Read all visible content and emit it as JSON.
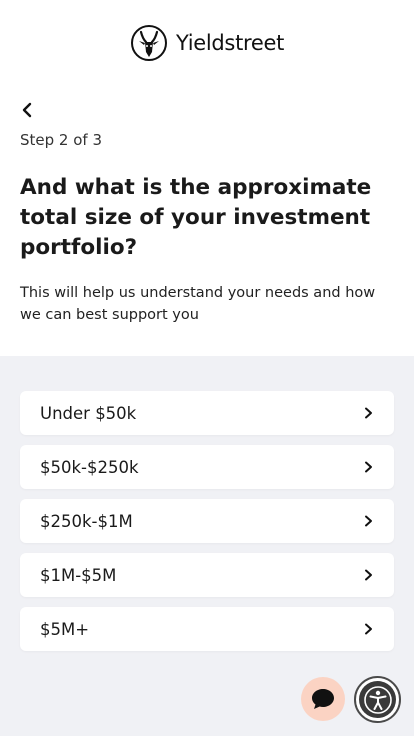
{
  "brand": {
    "name": "Yieldstreet",
    "logo_icon": "antelope-head-icon"
  },
  "nav": {
    "back_icon": "chevron-left-icon"
  },
  "step_label": "Step 2 of 3",
  "question": "And what is the approximate total size of your investment portfolio?",
  "subtitle": "This will help us understand your needs and how we can best support you",
  "options": [
    {
      "label": "Under $50k"
    },
    {
      "label": "$50k-$250k"
    },
    {
      "label": "$250k-$1M"
    },
    {
      "label": "$1M-$5M"
    },
    {
      "label": "$5M+"
    }
  ],
  "floating": {
    "chat_icon": "chat-bubble-icon",
    "accessibility_icon": "accessibility-icon"
  },
  "colors": {
    "panel_bg": "#f0f1f5",
    "chat_bg": "#fbd3c3",
    "text": "#1a1a1a"
  }
}
